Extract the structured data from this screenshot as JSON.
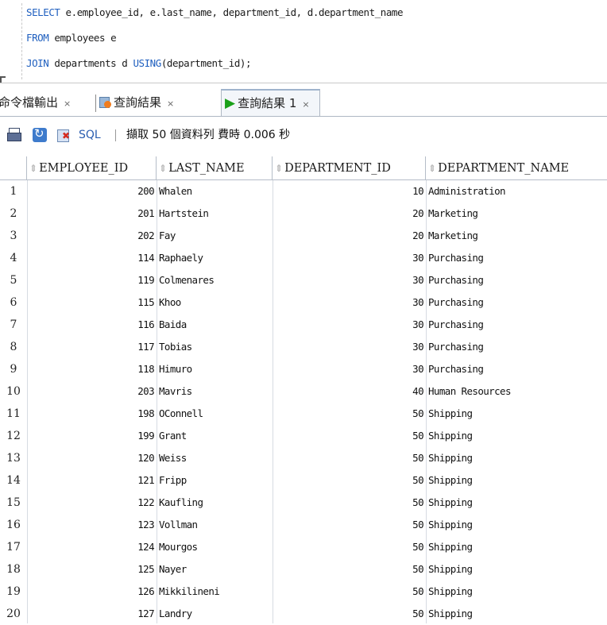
{
  "editor": {
    "lines": [
      {
        "kw": "SELECT",
        "rest": " e.employee_id, e.last_name, department_id, d.department_name"
      },
      {
        "kw": "FROM",
        "rest": " employees e"
      },
      {
        "kw": "JOIN",
        "rest": " departments d ",
        "kw2": "USING",
        "rest2": "(department_id);"
      }
    ]
  },
  "tabs": [
    {
      "label": "命令檔輸出",
      "close": "×",
      "icon": "script-output-icon"
    },
    {
      "label": "查詢結果",
      "close": "×",
      "icon": "query-result-icon"
    },
    {
      "label": "查詢結果 1",
      "close": "×",
      "icon": "run-triangle-icon",
      "active": true
    }
  ],
  "toolbar": {
    "icons": [
      "print-icon",
      "refresh-icon",
      "cancel-query-icon"
    ],
    "sql_label": "SQL",
    "status": "擷取 50 個資料列 費時 0.006 秒"
  },
  "grid": {
    "sort_glyph": "⇕",
    "columns": [
      "EMPLOYEE_ID",
      "LAST_NAME",
      "DEPARTMENT_ID",
      "DEPARTMENT_NAME"
    ],
    "rows": [
      {
        "n": "1",
        "employee_id": "200",
        "last_name": "Whalen",
        "department_id": "10",
        "department_name": "Administration"
      },
      {
        "n": "2",
        "employee_id": "201",
        "last_name": "Hartstein",
        "department_id": "20",
        "department_name": "Marketing"
      },
      {
        "n": "3",
        "employee_id": "202",
        "last_name": "Fay",
        "department_id": "20",
        "department_name": "Marketing"
      },
      {
        "n": "4",
        "employee_id": "114",
        "last_name": "Raphaely",
        "department_id": "30",
        "department_name": "Purchasing"
      },
      {
        "n": "5",
        "employee_id": "119",
        "last_name": "Colmenares",
        "department_id": "30",
        "department_name": "Purchasing"
      },
      {
        "n": "6",
        "employee_id": "115",
        "last_name": "Khoo",
        "department_id": "30",
        "department_name": "Purchasing"
      },
      {
        "n": "7",
        "employee_id": "116",
        "last_name": "Baida",
        "department_id": "30",
        "department_name": "Purchasing"
      },
      {
        "n": "8",
        "employee_id": "117",
        "last_name": "Tobias",
        "department_id": "30",
        "department_name": "Purchasing"
      },
      {
        "n": "9",
        "employee_id": "118",
        "last_name": "Himuro",
        "department_id": "30",
        "department_name": "Purchasing"
      },
      {
        "n": "10",
        "employee_id": "203",
        "last_name": "Mavris",
        "department_id": "40",
        "department_name": "Human Resources"
      },
      {
        "n": "11",
        "employee_id": "198",
        "last_name": "OConnell",
        "department_id": "50",
        "department_name": "Shipping"
      },
      {
        "n": "12",
        "employee_id": "199",
        "last_name": "Grant",
        "department_id": "50",
        "department_name": "Shipping"
      },
      {
        "n": "13",
        "employee_id": "120",
        "last_name": "Weiss",
        "department_id": "50",
        "department_name": "Shipping"
      },
      {
        "n": "14",
        "employee_id": "121",
        "last_name": "Fripp",
        "department_id": "50",
        "department_name": "Shipping"
      },
      {
        "n": "15",
        "employee_id": "122",
        "last_name": "Kaufling",
        "department_id": "50",
        "department_name": "Shipping"
      },
      {
        "n": "16",
        "employee_id": "123",
        "last_name": "Vollman",
        "department_id": "50",
        "department_name": "Shipping"
      },
      {
        "n": "17",
        "employee_id": "124",
        "last_name": "Mourgos",
        "department_id": "50",
        "department_name": "Shipping"
      },
      {
        "n": "18",
        "employee_id": "125",
        "last_name": "Nayer",
        "department_id": "50",
        "department_name": "Shipping"
      },
      {
        "n": "19",
        "employee_id": "126",
        "last_name": "Mikkilineni",
        "department_id": "50",
        "department_name": "Shipping"
      },
      {
        "n": "20",
        "employee_id": "127",
        "last_name": "Landry",
        "department_id": "50",
        "department_name": "Shipping"
      }
    ]
  }
}
